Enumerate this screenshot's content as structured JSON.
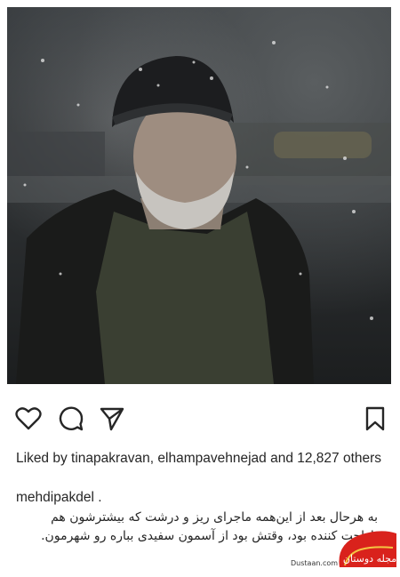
{
  "post": {
    "likes_text": "Liked by tinapakravan, elhampavehnejad and 12,827 others",
    "username": "mehdipakdel .",
    "caption": "به هرحال بعد از این‌همه ماجرای ریز و درشت که بیشترشون هم ناراحت کننده بود، وقتش بود از آسمون سفیدی بباره رو شهرمون."
  },
  "icons": {
    "like": "heart-icon",
    "comment": "comment-icon",
    "share": "paper-plane-icon",
    "save": "bookmark-icon"
  },
  "watermark": {
    "logo_text": "مجله دوستان",
    "url": "Dustaan.com",
    "color": "#d9221c"
  }
}
